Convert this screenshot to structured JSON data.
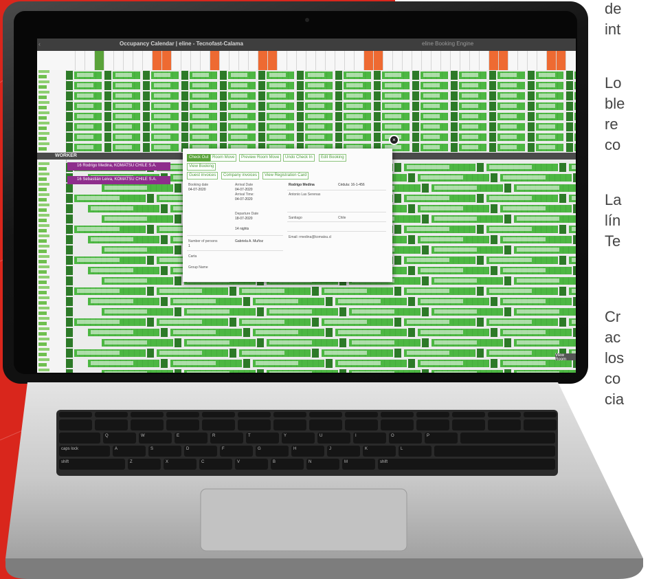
{
  "screen": {
    "title": "Occupancy Calendar | eline - Tecnofast-Calama",
    "second_tab": "eline Booking Engine",
    "section_label": "WORKER",
    "view_room": "View Room"
  },
  "side_text": [
    "de",
    "int",
    "Lo",
    "ble",
    "re",
    "co",
    "La",
    "lín",
    "Te",
    "Cr",
    "ac",
    "los",
    "co",
    "cia"
  ],
  "popup": {
    "buttons": [
      "Check Out",
      "Room Move",
      "Preview Room Move",
      "Undo Check In",
      "Edit Booking",
      "View Booking"
    ],
    "buttons2": [
      "Guest invoices",
      "Company invoices",
      "View Registration Card"
    ],
    "booking_date_label": "Booking date",
    "booking_date": "04-07-2020",
    "arrival_label": "Arrival Date",
    "arrival": "04-07-2020",
    "arrival_time_label": "Arrival Time:",
    "arrival_time": "04-07-2020",
    "departure_label": "Departure Date",
    "departure": "18-07-2020",
    "nights": "14 nights",
    "persons_label": "Number of persons",
    "persons": "1",
    "carta_label": "Carta",
    "group_label": "Group Name",
    "guest_name": "Rodrigo Medina",
    "guest_id": "Cédula: 16-1-456",
    "address": "Antonio Las Serenas",
    "city": "Santiago",
    "country": "Chile",
    "email": "Email: rmedina@komatsu.cl",
    "company": "Gabriela A. Muñoz"
  },
  "purple_bars": [
    "16 Rodrigo Medina, KOMATSU CHILE S.A.",
    "16 Sebastián Leiva, KOMATSU CHILE S.A."
  ],
  "keyboard": {
    "row3": [
      "Q",
      "W",
      "E",
      "R",
      "T",
      "Y",
      "U",
      "I",
      "O",
      "P"
    ],
    "row4": [
      "A",
      "S",
      "D",
      "F",
      "G",
      "H",
      "J",
      "K",
      "L"
    ],
    "row5": [
      "Z",
      "X",
      "C",
      "V",
      "B",
      "N",
      "M"
    ],
    "mods": [
      "caps lock",
      "shift",
      "control",
      "option",
      "command",
      "command",
      "option"
    ]
  }
}
